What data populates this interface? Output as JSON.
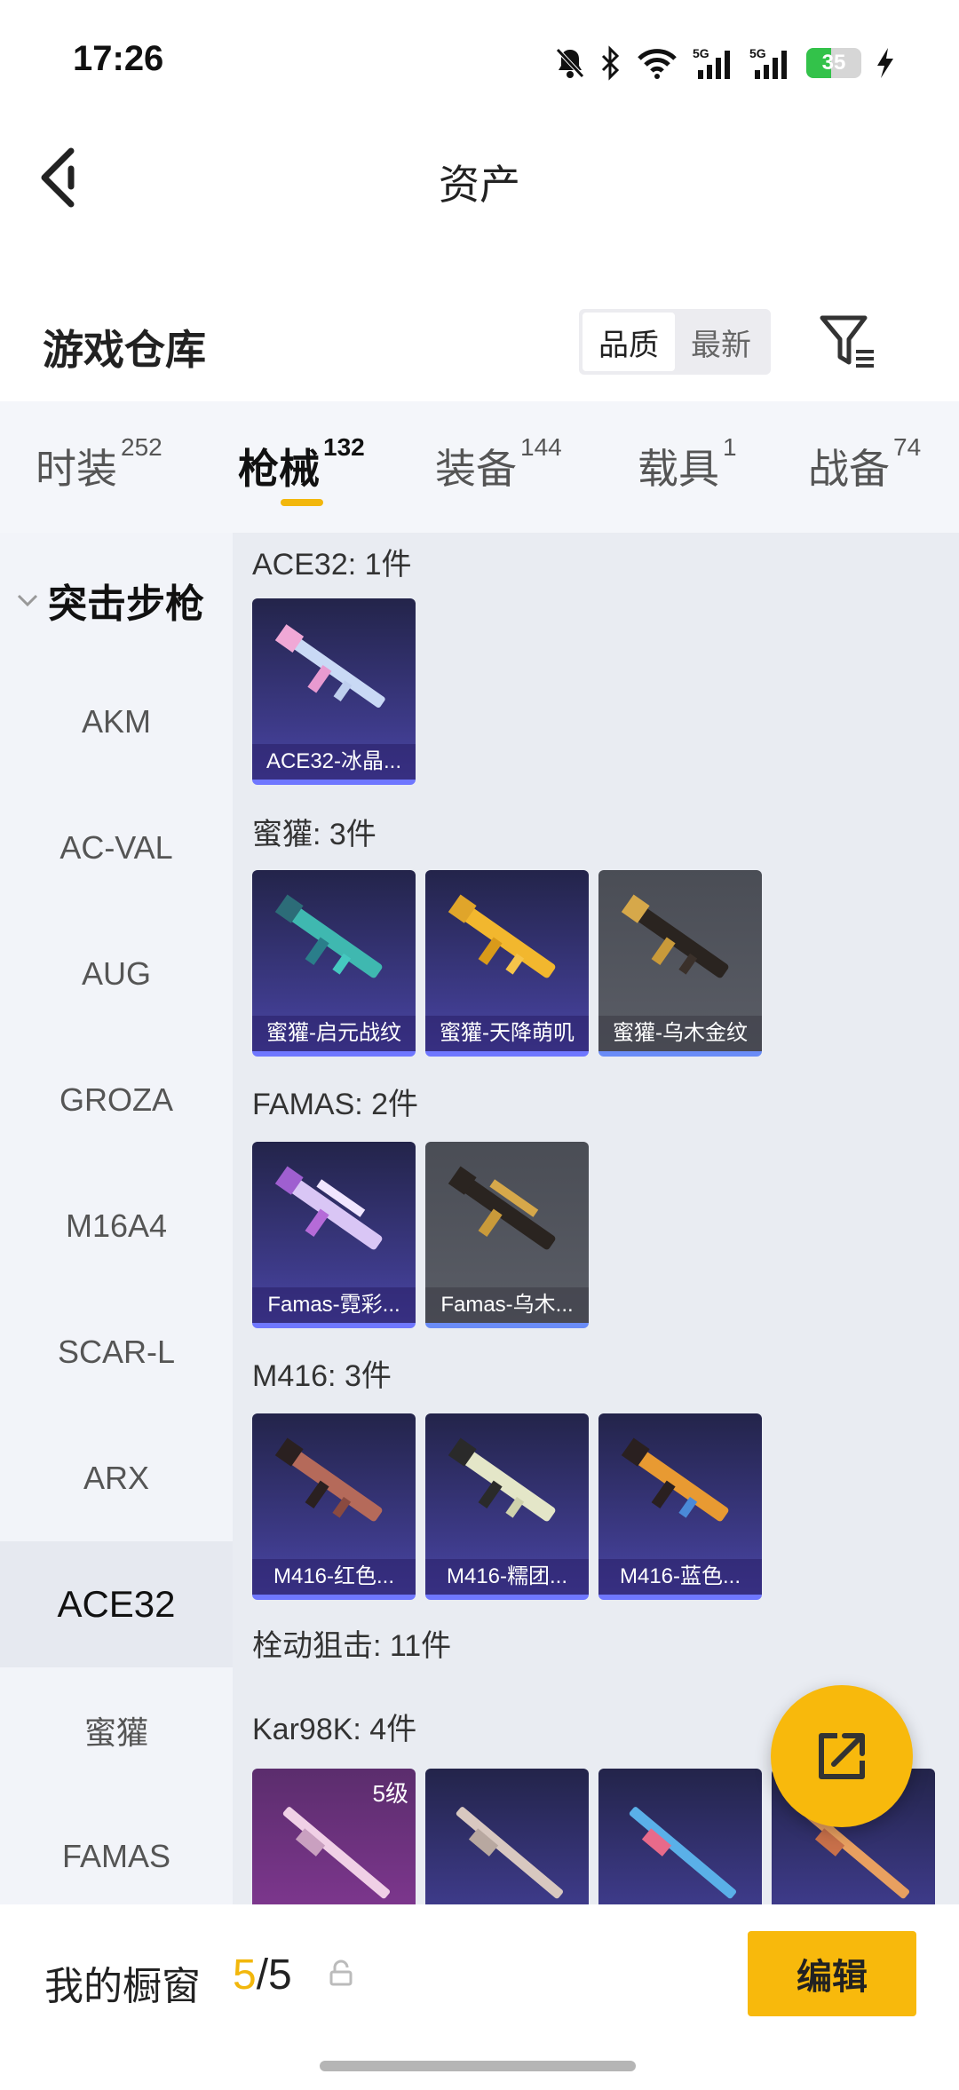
{
  "status": {
    "time": "17:26",
    "battery": "35"
  },
  "topbar": {
    "title": "资产"
  },
  "warehouse": {
    "title": "游戏仓库",
    "sort_options": [
      "品质",
      "最新"
    ]
  },
  "tabs": [
    {
      "label": "时装",
      "count": "252"
    },
    {
      "label": "枪械",
      "count": "132"
    },
    {
      "label": "装备",
      "count": "144"
    },
    {
      "label": "载具",
      "count": "1"
    },
    {
      "label": "战备",
      "count": "74"
    }
  ],
  "sidebar": {
    "category": "突击步枪",
    "items": [
      "AKM",
      "AC-VAL",
      "AUG",
      "GROZA",
      "M16A4",
      "SCAR-L",
      "ARX",
      "ACE32",
      "蜜獾",
      "FAMAS"
    ],
    "active": "ACE32"
  },
  "groups": [
    {
      "title": "ACE32: 1件",
      "items": [
        "ACE32-冰晶..."
      ]
    },
    {
      "title": "蜜獾: 3件",
      "items": [
        "蜜獾-启元战纹",
        "蜜獾-天降萌叽",
        "蜜獾-乌木金纹"
      ]
    },
    {
      "title": "FAMAS: 2件",
      "items": [
        "Famas-霓彩...",
        "Famas-乌木..."
      ]
    },
    {
      "title": "M416: 3件",
      "items": [
        "M416-红色...",
        "M416-糯团...",
        "M416-蓝色..."
      ]
    },
    {
      "title": "栓动狙击: 11件"
    },
    {
      "title": "Kar98K: 4件",
      "level": "5级"
    }
  ],
  "bottom": {
    "title": "我的橱窗",
    "count_current": "5",
    "count_sep": "/",
    "count_total": "5",
    "edit_label": "编辑"
  },
  "colors": {
    "accent": "#f8b90c",
    "card_border": "#6f77ff"
  }
}
